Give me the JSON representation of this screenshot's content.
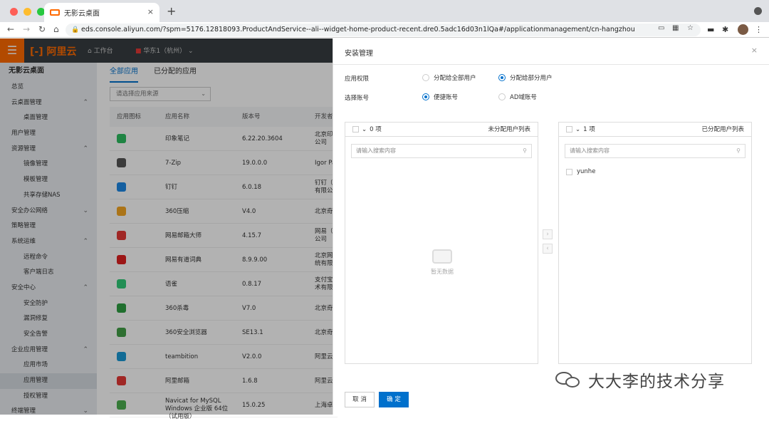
{
  "browser": {
    "tab_title": "无影云桌面",
    "url": "eds.console.aliyun.com/?spm=5176.12818093.ProductAndService--ali--widget-home-product-recent.dre0.5adc16d03n1lQa#/applicationmanagement/cn-hangzhou"
  },
  "topnav": {
    "logo": "阿里云",
    "workbench": "工作台",
    "region": "华东1（杭州）"
  },
  "sidebar": {
    "title": "无影云桌面",
    "items": [
      {
        "label": "总览",
        "sub": false,
        "chevron": ""
      },
      {
        "label": "云桌面管理",
        "sub": false,
        "chevron": "^"
      },
      {
        "label": "桌面管理",
        "sub": true,
        "chevron": ""
      },
      {
        "label": "用户管理",
        "sub": false,
        "chevron": ""
      },
      {
        "label": "资源管理",
        "sub": false,
        "chevron": "^"
      },
      {
        "label": "镜像管理",
        "sub": true,
        "chevron": ""
      },
      {
        "label": "模板管理",
        "sub": true,
        "chevron": ""
      },
      {
        "label": "共享存储NAS",
        "sub": true,
        "chevron": ""
      },
      {
        "label": "安全办公网络",
        "sub": false,
        "chevron": "v"
      },
      {
        "label": "策略管理",
        "sub": false,
        "chevron": ""
      },
      {
        "label": "系统运维",
        "sub": false,
        "chevron": "^"
      },
      {
        "label": "远程命令",
        "sub": true,
        "chevron": ""
      },
      {
        "label": "客户端日志",
        "sub": true,
        "chevron": ""
      },
      {
        "label": "安全中心",
        "sub": false,
        "chevron": "^"
      },
      {
        "label": "安全防护",
        "sub": true,
        "chevron": ""
      },
      {
        "label": "漏洞修复",
        "sub": true,
        "chevron": ""
      },
      {
        "label": "安全告警",
        "sub": true,
        "chevron": ""
      },
      {
        "label": "企业应用管理",
        "sub": false,
        "chevron": "^"
      },
      {
        "label": "应用市场",
        "sub": true,
        "chevron": ""
      },
      {
        "label": "应用管理",
        "sub": true,
        "chevron": "",
        "active": true
      },
      {
        "label": "授权管理",
        "sub": true,
        "chevron": ""
      },
      {
        "label": "终端管理",
        "sub": false,
        "chevron": "v"
      }
    ]
  },
  "main": {
    "tabs": [
      "全部应用",
      "已分配的应用"
    ],
    "filter_placeholder": "请选择应用来源",
    "columns": [
      "应用图标",
      "应用名称",
      "版本号",
      "开发者"
    ],
    "rows": [
      {
        "name": "印象笔记",
        "version": "6.22.20.3604",
        "dev": "北京印\n公司",
        "color": "#2dbe60"
      },
      {
        "name": "7-Zip",
        "version": "19.0.0.0",
        "dev": "Igor Pa",
        "color": "#555555"
      },
      {
        "name": "钉钉",
        "version": "6.0.18",
        "dev": "钉钉（\n有限公",
        "color": "#1e88e5"
      },
      {
        "name": "360压缩",
        "version": "V4.0",
        "dev": "北京奇",
        "color": "#f5a623"
      },
      {
        "name": "网易邮箱大师",
        "version": "4.15.7",
        "dev": "网易（\n公司",
        "color": "#e53935"
      },
      {
        "name": "网易有道词典",
        "version": "8.9.9.00",
        "dev": "北京网\n统有限",
        "color": "#e02020"
      },
      {
        "name": "语雀",
        "version": "0.8.17",
        "dev": "支付宝\n术有限",
        "color": "#31cc79"
      },
      {
        "name": "360杀毒",
        "version": "V7.0",
        "dev": "北京奇",
        "color": "#2ea043"
      },
      {
        "name": "360安全浏览器",
        "version": "SE13.1",
        "dev": "北京奇",
        "color": "#43a047"
      },
      {
        "name": "teambition",
        "version": "V2.0.0",
        "dev": "阿里云",
        "color": "#1a9ad6"
      },
      {
        "name": "阿里邮箱",
        "version": "1.6.8",
        "dev": "阿里云",
        "color": "#e53935"
      },
      {
        "name": "Navicat for MySQL Windows 企业版 64位（试用版）",
        "version": "15.0.25",
        "dev": "上海卓",
        "color": "#4caf50"
      }
    ]
  },
  "drawer": {
    "title": "安装管理",
    "close": "×",
    "app_perm_label": "应用权限",
    "perm_all": "分配给全部用户",
    "perm_part": "分配给部分用户",
    "account_label": "选择账号",
    "acc_quick": "便捷账号",
    "acc_ad": "AD域账号",
    "left_panel": {
      "count": "0 项",
      "title": "未分配用户列表",
      "search_placeholder": "请输入搜索内容",
      "empty": "暂无数据"
    },
    "right_panel": {
      "count": "1 项",
      "title": "已分配用户列表",
      "search_placeholder": "请输入搜索内容",
      "users": [
        "yunhe"
      ]
    },
    "cancel": "取 消",
    "confirm": "确 定"
  },
  "watermark": "大大李的技术分享"
}
